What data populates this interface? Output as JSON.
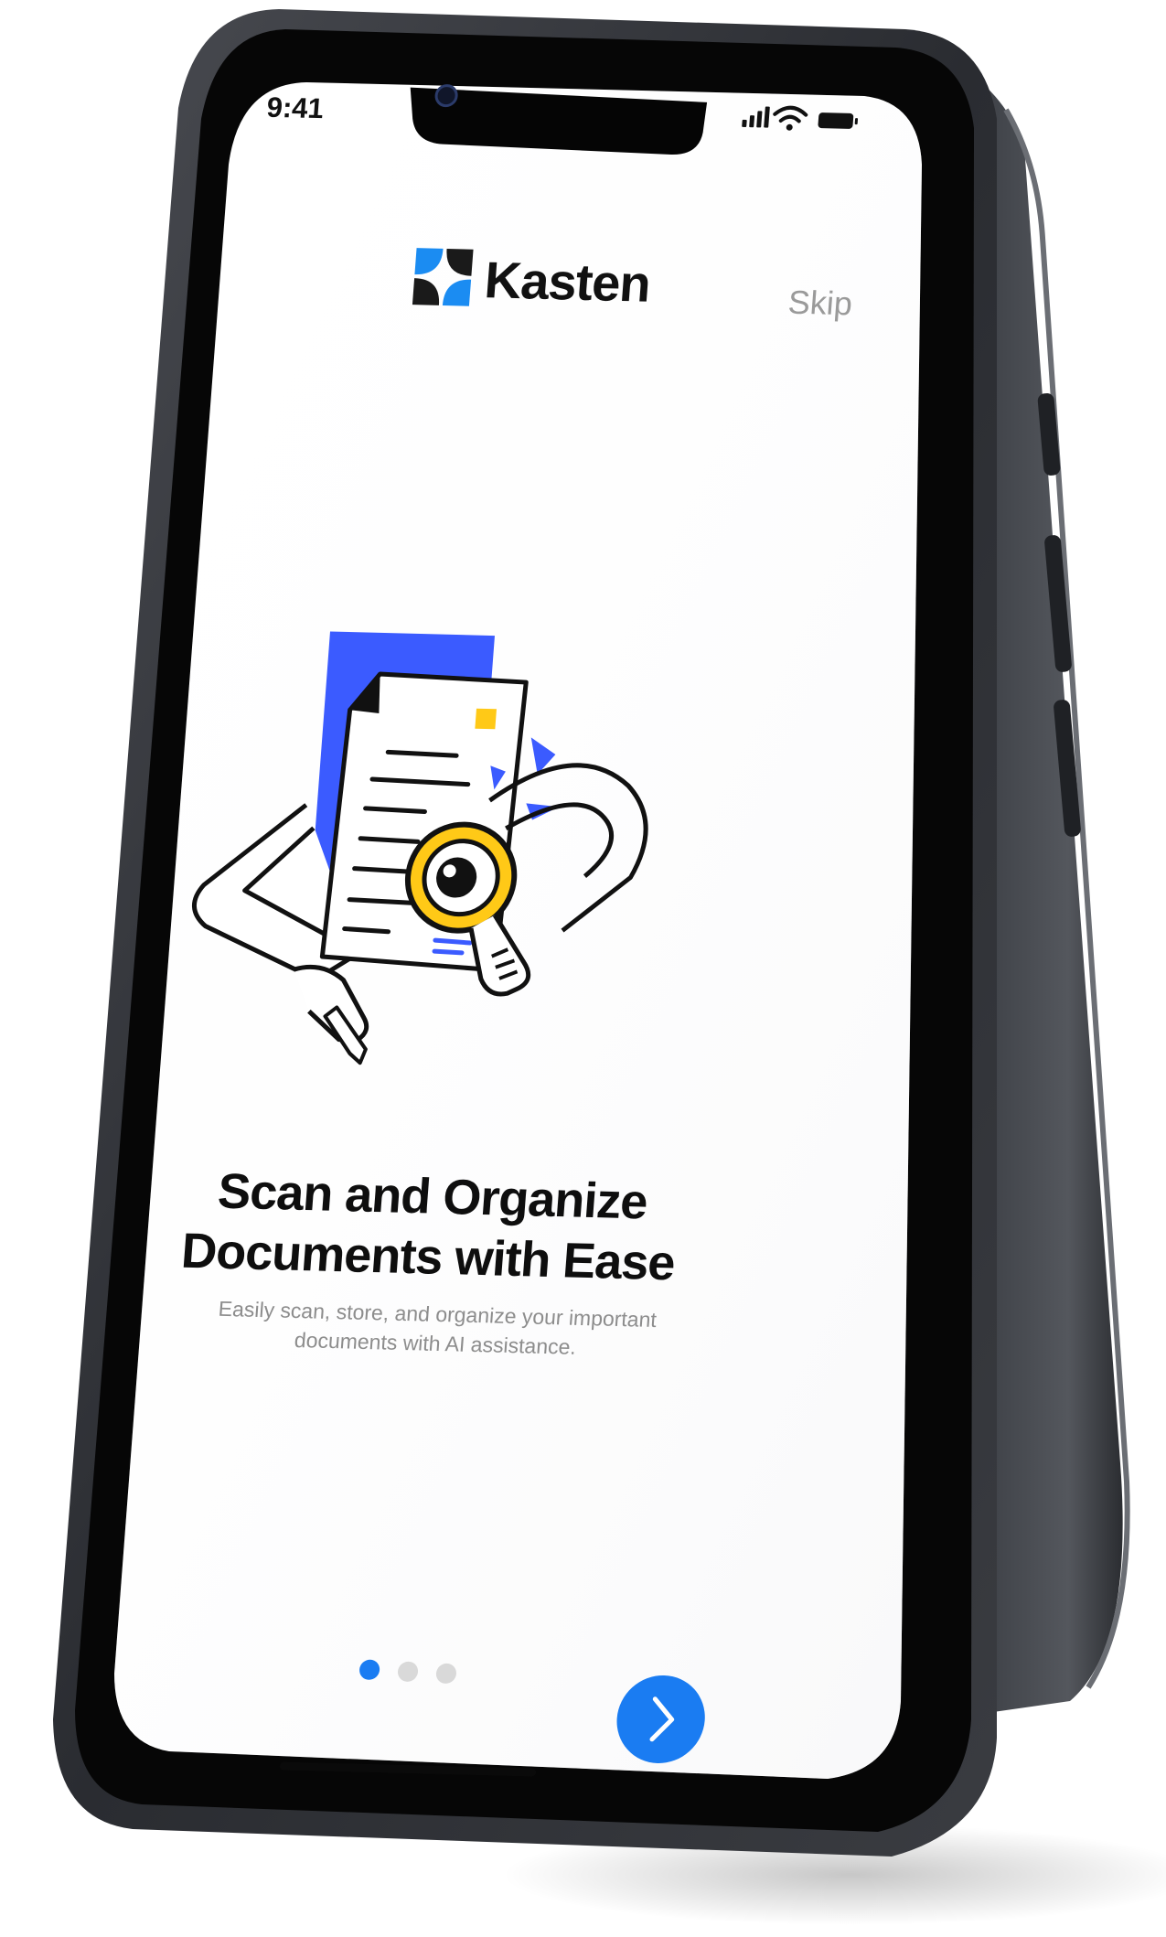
{
  "status_bar": {
    "time": "9:41"
  },
  "brand": {
    "name": "Kasten",
    "logo_colors": [
      "#1a1a1a",
      "#1b8cf2"
    ]
  },
  "header": {
    "skip_label": "Skip"
  },
  "onboarding": {
    "title_line_1": "Scan and Organize",
    "title_line_2": "Documents with Ease",
    "subtitle_line_1": "Easily scan, store, and organize your important",
    "subtitle_line_2": "documents with AI assistance.",
    "page_count": 3,
    "current_page": 1,
    "next_icon": "chevron-right-icon"
  },
  "illustration": {
    "name": "document-magnifier-illustration",
    "colors": {
      "accent_blue": "#3b5bff",
      "accent_yellow": "#ffc917",
      "line": "#111111"
    }
  },
  "colors": {
    "primary": "#1a7cf2",
    "dot_active": "#1a7cf2",
    "dot_inactive": "#d9d9d9",
    "phone_frame": "#2a2c31"
  }
}
